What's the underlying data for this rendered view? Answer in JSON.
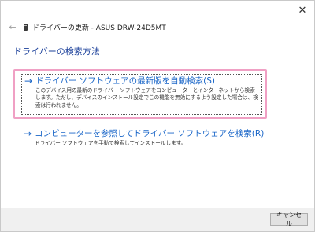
{
  "window": {
    "title": "ドライバーの更新 - ASUS DRW-24D5MT",
    "close_glyph": "✕",
    "back_glyph": "←"
  },
  "page": {
    "title": "ドライバーの検索方法"
  },
  "options": [
    {
      "title": "ドライバー ソフトウェアの最新版を自動検索(S)",
      "description": "このデバイス用の最新のドライバー ソフトウェアをコンピューターとインターネットから検索します。ただし、デバイスのインストール設定でこの機能を無効にするよう設定した場合は、検索は行われません。",
      "selected": true
    },
    {
      "title": "コンピューターを参照してドライバー ソフトウェアを検索(R)",
      "description": "ドライバー ソフトウェアを手動で検索してインストールします。",
      "selected": false
    }
  ],
  "option_arrow_glyph": "→",
  "footer": {
    "cancel_label": "キャンセル"
  },
  "colors": {
    "link_blue": "#1a66c8",
    "title_blue": "#1a3f9a",
    "highlight_pink": "#f0a0c4",
    "footer_bg": "#f0f0f0"
  },
  "icons": {
    "back": "back-arrow-icon",
    "device": "optical-drive-icon",
    "close": "close-icon",
    "option_arrow": "arrow-right-icon"
  }
}
